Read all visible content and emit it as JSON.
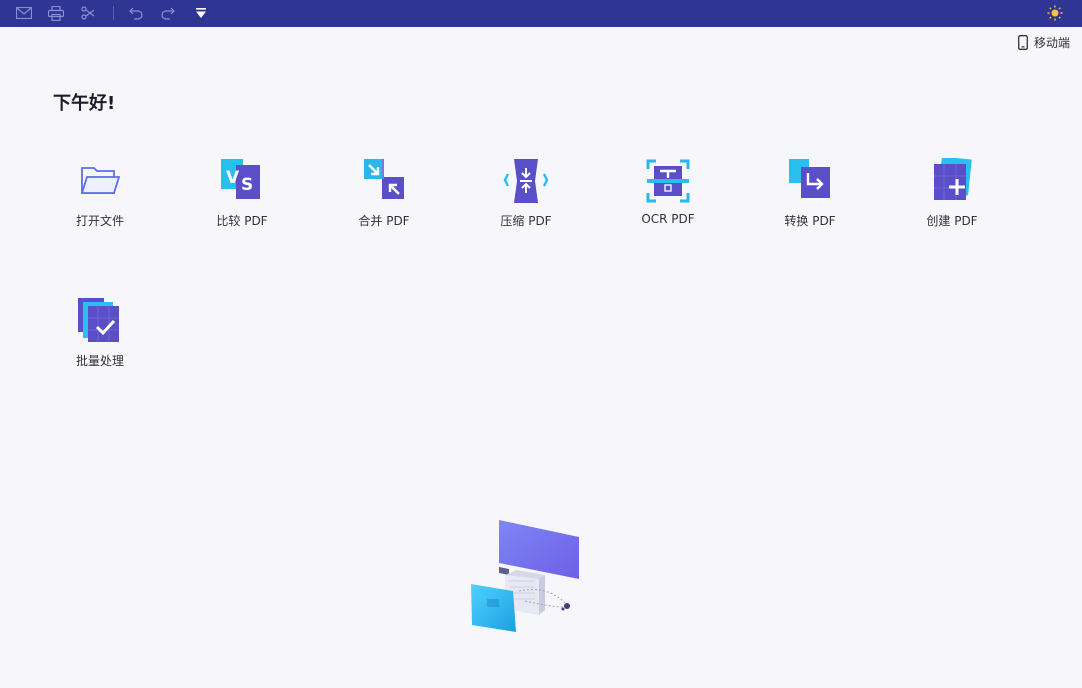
{
  "titlebar": {
    "icons": [
      "mail-icon",
      "print-icon",
      "share-icon",
      "undo-icon",
      "redo-icon",
      "dropdown-icon",
      "theme-sun-icon"
    ]
  },
  "mobile": {
    "label": "移动端"
  },
  "greeting": "下午好!",
  "tools": [
    {
      "key": "open",
      "label": "打开文件",
      "icon": "folder-icon"
    },
    {
      "key": "compare",
      "label": "比较 PDF",
      "icon": "compare-icon"
    },
    {
      "key": "merge",
      "label": "合并 PDF",
      "icon": "merge-icon"
    },
    {
      "key": "compress",
      "label": "压缩 PDF",
      "icon": "compress-icon"
    },
    {
      "key": "ocr",
      "label": "OCR PDF",
      "icon": "ocr-icon"
    },
    {
      "key": "convert",
      "label": "转换 PDF",
      "icon": "convert-icon"
    },
    {
      "key": "create",
      "label": "创建 PDF",
      "icon": "create-icon"
    },
    {
      "key": "batch",
      "label": "批量处理",
      "icon": "batch-icon"
    }
  ],
  "colors": {
    "titlebar": "#2f3593",
    "accent": "#6a63d9",
    "background": "#f7f7fb"
  }
}
